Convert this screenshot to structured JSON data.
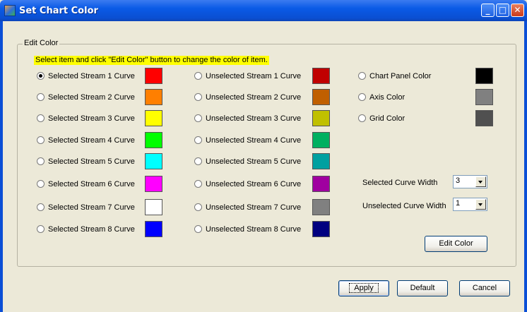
{
  "window": {
    "title": "Set Chart Color",
    "title_icon": "app-icon"
  },
  "group": {
    "legend": "Edit Color",
    "hint": "Select item and click \"Edit Color\" button to change the color of item."
  },
  "selected_curves": [
    {
      "label": "Selected Stream 1 Curve",
      "color": "#ff0000",
      "checked": true
    },
    {
      "label": "Selected Stream 2 Curve",
      "color": "#ff7f00",
      "checked": false
    },
    {
      "label": "Selected Stream 3 Curve",
      "color": "#ffff00",
      "checked": false
    },
    {
      "label": "Selected Stream 4 Curve",
      "color": "#00ff00",
      "checked": false
    },
    {
      "label": "Selected Stream 5 Curve",
      "color": "#00ffff",
      "checked": false
    },
    {
      "label": "Selected Stream 6 Curve",
      "color": "#ff00ff",
      "checked": false
    },
    {
      "label": "Selected Stream 7 Curve",
      "color": "#ffffff",
      "checked": false
    },
    {
      "label": "Selected Stream 8 Curve",
      "color": "#0000ff",
      "checked": false
    }
  ],
  "unselected_curves": [
    {
      "label": "Unselected Stream 1 Curve",
      "color": "#c00000",
      "checked": false
    },
    {
      "label": "Unselected Stream 2 Curve",
      "color": "#c05f00",
      "checked": false
    },
    {
      "label": "Unselected Stream 3 Curve",
      "color": "#c0c000",
      "checked": false
    },
    {
      "label": "Unselected Stream 4 Curve",
      "color": "#00b060",
      "checked": false
    },
    {
      "label": "Unselected Stream 5 Curve",
      "color": "#00a0a0",
      "checked": false
    },
    {
      "label": "Unselected Stream 6 Curve",
      "color": "#a000a0",
      "checked": false
    },
    {
      "label": "Unselected Stream 7 Curve",
      "color": "#808080",
      "checked": false
    },
    {
      "label": "Unselected Stream 8 Curve",
      "color": "#000080",
      "checked": false
    }
  ],
  "chart_items": [
    {
      "label": "Chart Panel Color",
      "color": "#000000",
      "checked": false
    },
    {
      "label": "Axis Color",
      "color": "#808080",
      "checked": false
    },
    {
      "label": "Grid Color",
      "color": "#505050",
      "checked": false
    }
  ],
  "widths": {
    "selected_label": "Selected Curve Width",
    "selected_value": "3",
    "unselected_label": "Unselected Curve Width",
    "unselected_value": "1"
  },
  "buttons": {
    "edit_color": "Edit Color",
    "apply": "Apply",
    "default": "Default",
    "cancel": "Cancel"
  }
}
